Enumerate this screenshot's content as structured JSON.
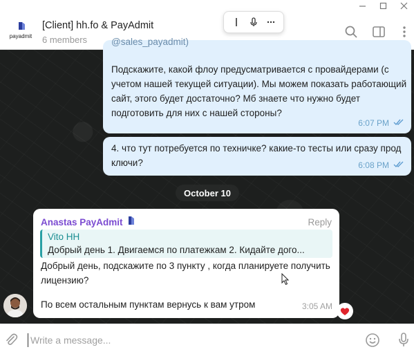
{
  "header": {
    "title": "[Client] hh.fo & PayAdmit",
    "subtitle": "6 members",
    "logo_text": "payadmit"
  },
  "messages_out": [
    {
      "cut_line": "@sales_payadmit)",
      "text": "Подскажите, какой флоу предусматривается с провайдерами (с учетом нашей текущей ситуации). Мы можем показать работающий сайт, этого будет достаточно? Мб знаете что нужно будет подготовить для них с нашей стороны?",
      "time": "6:07 PM"
    },
    {
      "text": "4. что тут потребуется по техничке? какие-то тесты или сразу прод ключи?",
      "time": "6:08 PM"
    }
  ],
  "date_separator": "October 10",
  "message_in": {
    "sender": "Anastas PayAdmit",
    "reply_label": "Reply",
    "quote_name": "Vito HH",
    "quote_text": "Добрый день  1. Двигаемся по платежкам 2. Кидайте дого...",
    "text1": "Добрый день, подскажите по 3 пункту , когда планируете получить лицензию?",
    "text2": "По всем остальным пунктам вернусь к вам утром",
    "time": "3:05 AM"
  },
  "composer": {
    "placeholder": "Write a message..."
  },
  "colors": {
    "outgoing_bubble": "#e1f0fd",
    "sender_name": "#7b4bd1",
    "quote_accent": "#2aa0a4",
    "check_marks": "#6aa2c9",
    "reaction_heart": "#e0242c"
  }
}
